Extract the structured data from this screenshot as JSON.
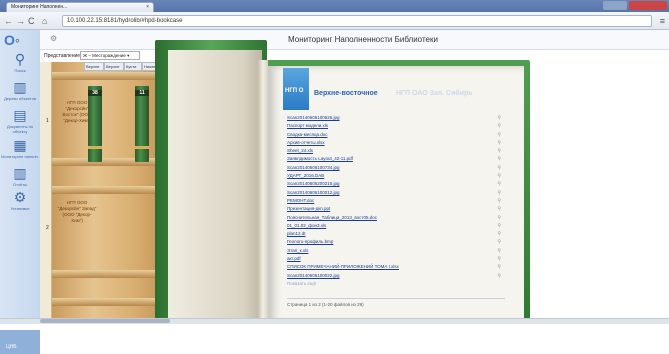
{
  "browser": {
    "tab_title": "Мониторинг Наполнен...",
    "tab_close": "×",
    "url": "10.100.22.15:8181/hydrolib/#hpd-bookcase"
  },
  "app": {
    "logo_text": "O",
    "title": "Мониторинг Наполненности Библиотеки",
    "nav": [
      {
        "label": "Поиск",
        "icon": "search-icon"
      },
      {
        "label": "Дерево объектов",
        "icon": "library-icon"
      },
      {
        "label": "Документы по объекту",
        "icon": "documents-icon"
      },
      {
        "label": "Мониторинг наполн.",
        "icon": "monitoring-icon"
      },
      {
        "label": "Отчёты",
        "icon": "reports-icon"
      },
      {
        "label": "Установки",
        "icon": "settings-icon"
      }
    ],
    "bottom_label": "ЦНБ"
  },
  "view": {
    "label": "Представление",
    "selected": "Ж – Местораждение"
  },
  "shelf": {
    "column_headers": [
      "Верхне",
      "Верхне",
      "Кусти",
      "Нижне"
    ],
    "rows": [
      {
        "number": "1",
        "label": "НГП ООО \"Декорсйн\" Восток\" (ООО \"Декор-Хим\")"
      },
      {
        "number": "2",
        "label": "НГП ООО \"Декорсйн\" Запад\" (ООО \"Декор-Хим\")"
      }
    ],
    "books": [
      {
        "number": "38"
      },
      {
        "number": "11"
      }
    ]
  },
  "book": {
    "tag": "НГП О",
    "title": "Верхне-восточное",
    "title_faded": "НГП ОАО Зап. Сибирь",
    "files": [
      "Scan20140606100526.jpg",
      "Паспорт модели.xls",
      "Сводка-месяца.doc",
      "Архив-отчеты.xlsx",
      "Sheet_24.xls",
      "Заявлдимость Layout_42-11.pdf",
      "Scan20140606100734.jpg",
      "УДАРТ_2016.DAB",
      "Scan20140606200215.jpg",
      "Scan20140606100012.jpg",
      "РЕМОНТ.doc",
      "Презентация-дкп.ppt",
      "Пояснительная_Таблица_2013_вост05.doc",
      "01_01.02_фон3.xls",
      "plan12.dt",
      "Геолого-профиль.bmp",
      "Этап_к.xls",
      "акт.pdf",
      "СПИСОК ПРИМЕЧАНИЙ-ПРИЛОЖЕНИЙ ТОМА I.xlsx",
      "Scan20140606100022.jpg"
    ],
    "show_more": "Показать ещё",
    "pager": "Страница 1 из 2 (1-20 файлов из 29)"
  }
}
